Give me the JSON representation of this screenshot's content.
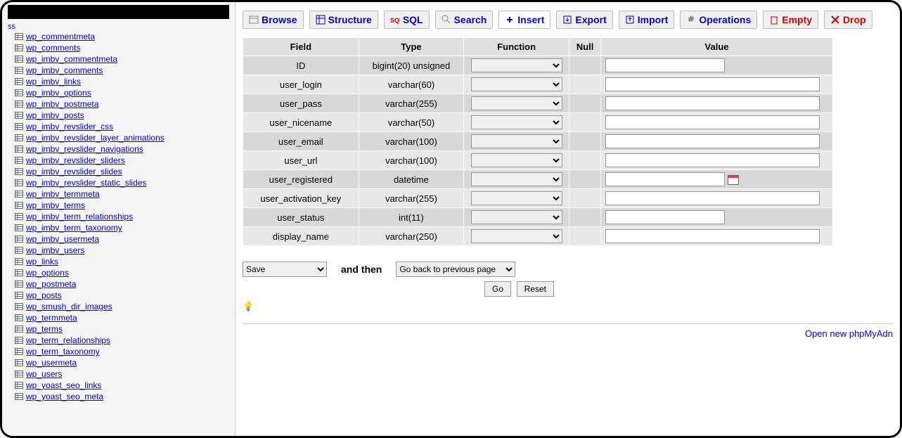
{
  "sidebar": {
    "prefix": "ss",
    "tables": [
      "wp_commentmeta",
      "wp_comments",
      "wp_imbv_commentmeta",
      "wp_imbv_comments",
      "wp_imbv_links",
      "wp_imbv_options",
      "wp_imbv_postmeta",
      "wp_imbv_posts",
      "wp_imbv_revslider_css",
      "wp_imbv_revslider_layer_animations",
      "wp_imbv_revslider_navigations",
      "wp_imbv_revslider_sliders",
      "wp_imbv_revslider_slides",
      "wp_imbv_revslider_static_slides",
      "wp_imbv_termmeta",
      "wp_imbv_terms",
      "wp_imbv_term_relationships",
      "wp_imbv_term_taxonomy",
      "wp_imbv_usermeta",
      "wp_imbv_users",
      "wp_links",
      "wp_options",
      "wp_postmeta",
      "wp_posts",
      "wp_smush_dir_images",
      "wp_termmeta",
      "wp_terms",
      "wp_term_relationships",
      "wp_term_taxonomy",
      "wp_usermeta",
      "wp_users",
      "wp_yoast_seo_links",
      "wp_yoast_seo_meta"
    ]
  },
  "tabs": [
    {
      "label": "Browse",
      "icon": "browse"
    },
    {
      "label": "Structure",
      "icon": "structure"
    },
    {
      "label": "SQL",
      "icon": "sql"
    },
    {
      "label": "Search",
      "icon": "search"
    },
    {
      "label": "Insert",
      "icon": "insert",
      "active": true
    },
    {
      "label": "Export",
      "icon": "export"
    },
    {
      "label": "Import",
      "icon": "import"
    },
    {
      "label": "Operations",
      "icon": "operations"
    },
    {
      "label": "Empty",
      "icon": "empty",
      "cls": "tab-empty"
    },
    {
      "label": "Drop",
      "icon": "drop",
      "cls": "tab-drop"
    }
  ],
  "headers": {
    "field": "Field",
    "type": "Type",
    "function": "Function",
    "null": "Null",
    "value": "Value"
  },
  "rows": [
    {
      "field": "ID",
      "type": "bigint(20) unsigned",
      "shortValue": true
    },
    {
      "field": "user_login",
      "type": "varchar(60)"
    },
    {
      "field": "user_pass",
      "type": "varchar(255)"
    },
    {
      "field": "user_nicename",
      "type": "varchar(50)"
    },
    {
      "field": "user_email",
      "type": "varchar(100)"
    },
    {
      "field": "user_url",
      "type": "varchar(100)"
    },
    {
      "field": "user_registered",
      "type": "datetime",
      "shortValue": true,
      "calendar": true
    },
    {
      "field": "user_activation_key",
      "type": "varchar(255)"
    },
    {
      "field": "user_status",
      "type": "int(11)",
      "shortValue": true
    },
    {
      "field": "display_name",
      "type": "varchar(250)"
    }
  ],
  "controls": {
    "save_options": [
      "Save"
    ],
    "and_then": "and then",
    "then_options": [
      "Go back to previous page"
    ],
    "go": "Go",
    "reset": "Reset"
  },
  "footer": {
    "link": "Open new phpMyAdn"
  }
}
